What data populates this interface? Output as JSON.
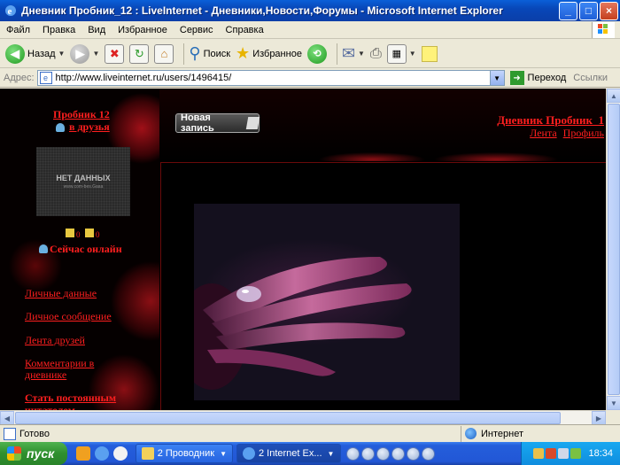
{
  "window": {
    "title": "Дневник Пробник_12 : LiveInternet - Дневники,Новости,Форумы - Microsoft Internet Explorer",
    "minimize": "_",
    "maximize": "□",
    "close": "×"
  },
  "menu": [
    "Файл",
    "Правка",
    "Вид",
    "Избранное",
    "Сервис",
    "Справка"
  ],
  "toolbar": {
    "back": "Назад",
    "search": "Поиск",
    "favorites": "Избранное"
  },
  "address": {
    "label": "Адрес:",
    "url": "http://www.liveinternet.ru/users/1496415/",
    "go": "Переход",
    "links": "Ссылки"
  },
  "page": {
    "username": "Пробник 12",
    "friends_label": "в друзья",
    "avatar_text": "НЕТ ДАННЫХ",
    "avatar_subtext": "www.com-bes.Gaaa",
    "counter1": "0",
    "counter2": "0",
    "online": "Сейчас онлайн",
    "new_post": "Новая запись",
    "diary_title": "Дневник Пробник_1",
    "diary_feed": "Лента",
    "diary_profile": "Профиль",
    "sidebar_links": [
      "Личные данные",
      "Личное сообщение",
      "Лента друзей",
      "Комментарии в дневнике",
      "Стать постоянным читателем"
    ]
  },
  "status": {
    "text": "Готово",
    "zone": "Интернет"
  },
  "taskbar": {
    "start": "пуск",
    "tasks": [
      "2 Проводник",
      "2 Internet Ex..."
    ],
    "clock": "18:34"
  }
}
